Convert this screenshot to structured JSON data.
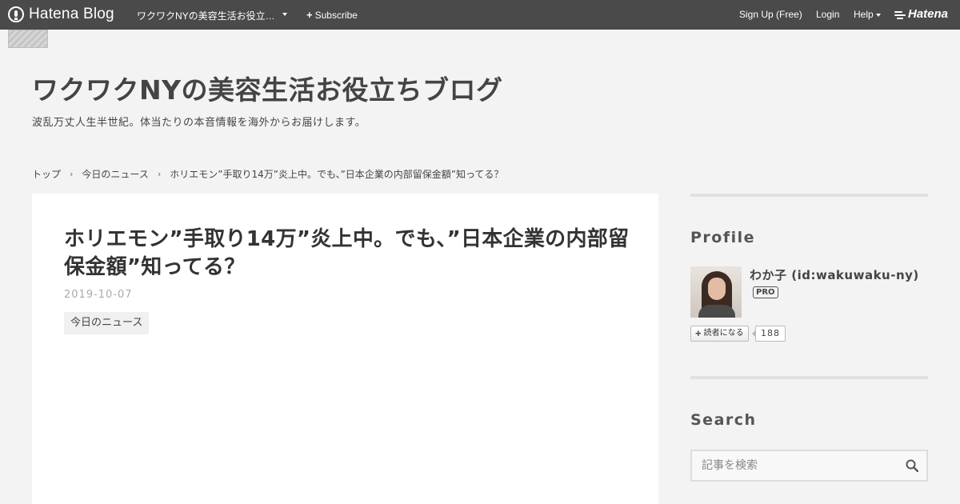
{
  "globalbar": {
    "logo_text": "Hatena Blog",
    "blog_name": "ワクワクNYの美容生活お役立…",
    "subscribe_label": "Subscribe",
    "signup_label": "Sign Up (Free)",
    "login_label": "Login",
    "help_label": "Help",
    "hatena_label": "Hatena"
  },
  "header": {
    "title": "ワクワクNYの美容生活お役立ちブログ",
    "description": "波乱万丈人生半世紀。体当たりの本音情報を海外からお届けします。"
  },
  "breadcrumb": {
    "items": [
      "トップ",
      "今日のニュース",
      "ホリエモン”手取り14万”炎上中。でも、”日本企業の内部留保金額”知ってる？"
    ],
    "separator": "›"
  },
  "article": {
    "title": "ホリエモン”手取り14万”炎上中。でも、”日本企業の内部留保金額”知ってる？",
    "date": "2019-10-07",
    "category": "今日のニュース"
  },
  "sidebar": {
    "profile": {
      "heading": "Profile",
      "name": "わか子 (id:wakuwaku-ny)",
      "badge": "PRO",
      "subscribe_label": "読者になる",
      "subscriber_count": "188"
    },
    "search": {
      "heading": "Search",
      "placeholder": "記事を検索"
    }
  },
  "icons": {
    "logo": "hatena-blog-logo-icon",
    "dropdown": "caret-down-icon",
    "plus": "plus-icon",
    "hatena_mark": "hatena-mark-icon",
    "search": "search-icon"
  },
  "colors": {
    "globalbar": "#4a4a4a",
    "page_background": "#f3f3f3",
    "card_background": "#ffffff",
    "text": "#444444"
  }
}
